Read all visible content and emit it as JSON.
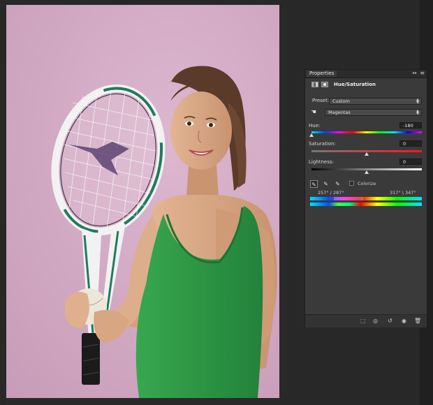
{
  "panel": {
    "title": "Properties",
    "collapse_glyph": "▸▸",
    "menu_glyph": "≡",
    "adjustment_title": "Hue/Saturation",
    "preset": {
      "label": "Preset:",
      "value": "Custom"
    },
    "range": {
      "value": "Magentas"
    },
    "hue": {
      "label": "Hue:",
      "value": "-180",
      "level": 0.0
    },
    "saturation": {
      "label": "Saturation:",
      "value": "0",
      "level": 0.5
    },
    "lightness": {
      "label": "Lightness:",
      "value": "0",
      "level": 0.5
    },
    "colorize": {
      "label": "Colorize",
      "checked": false
    },
    "color_range": {
      "left": "257° / 287°",
      "right": "317° \\ 347°"
    }
  },
  "icons": {
    "adjustment": "adjustment-layer-icon",
    "mask": "layer-mask-icon",
    "hand": "targeted-adjustment-hand-icon",
    "eyedroppers": [
      "eyedropper-icon",
      "eyedropper-plus-icon",
      "eyedropper-minus-icon"
    ],
    "footer": [
      "clip-to-layer-icon",
      "view-previous-state-icon",
      "reset-icon",
      "visibility-icon",
      "delete-icon"
    ]
  },
  "colors": {
    "backdrop": "#d6abc7",
    "shirt": "#2f9a45",
    "racket_accent": "#1f7b5c",
    "workspace": "#282828",
    "panel": "#3a3a3a"
  }
}
